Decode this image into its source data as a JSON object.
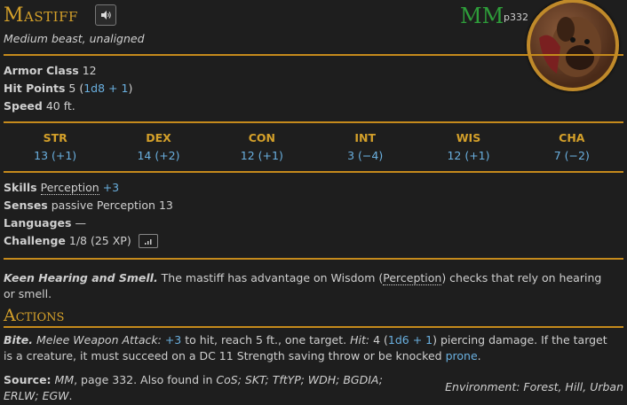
{
  "name": "Mastiff",
  "source": {
    "abbr": "MM",
    "page": "p332"
  },
  "subtitle": "Medium beast, unaligned",
  "stats": {
    "ac_label": "Armor Class",
    "ac_value": "12",
    "hp_label": "Hit Points",
    "hp_value": "5 (",
    "hp_formula": "1d8 + 1",
    "hp_close": ")",
    "speed_label": "Speed",
    "speed_value": "40 ft."
  },
  "abilities": [
    {
      "name": "STR",
      "value": "13 (+1)"
    },
    {
      "name": "DEX",
      "value": "14 (+2)"
    },
    {
      "name": "CON",
      "value": "12 (+1)"
    },
    {
      "name": "INT",
      "value": "3 (−4)"
    },
    {
      "name": "WIS",
      "value": "12 (+1)"
    },
    {
      "name": "CHA",
      "value": "7 (−2)"
    }
  ],
  "details": {
    "skills_label": "Skills",
    "skills_name": "Perception",
    "skills_bonus": "+3",
    "senses_label": "Senses",
    "senses_value": "passive Perception 13",
    "languages_label": "Languages",
    "languages_value": "—",
    "challenge_label": "Challenge",
    "challenge_value": "1/8 (25 XP)"
  },
  "trait": {
    "name": "Keen Hearing and Smell.",
    "text_a": " The mastiff has advantage on Wisdom (",
    "text_link": "Perception",
    "text_b": ") checks that rely on hearing or smell."
  },
  "actions_title": "Actions",
  "action": {
    "name": "Bite.",
    "type": " Melee Weapon Attack:",
    "bonus": "+3",
    "t1": " to hit, reach 5 ft., one target. ",
    "hit": "Hit:",
    "t2": " 4 (",
    "dmg": "1d6 + 1",
    "t3": ") piercing damage. If the target is a creature, it must succeed on a DC 11 Strength saving throw or be knocked ",
    "cond": "prone",
    "t4": "."
  },
  "footer": {
    "source_label": "Source:",
    "src_book": "MM",
    "src_t1": ", page 332. Also found in ",
    "also": "CoS; SKT; TftYP; WDH; BGDIA; ERLW; EGW",
    "src_end": ".",
    "environment": "Environment: Forest, Hill, Urban"
  },
  "colors": {
    "accent": "#d4a02a",
    "link": "#6ab0e0",
    "rule": "#c58a1c",
    "source": "#2e9e3a"
  }
}
